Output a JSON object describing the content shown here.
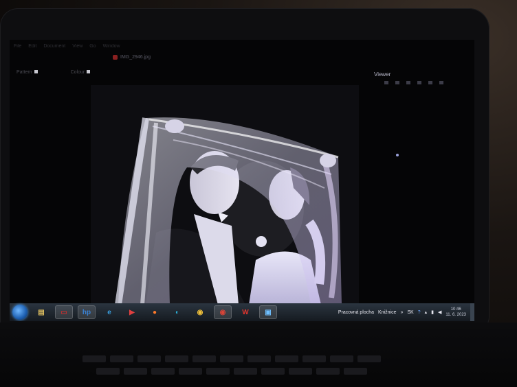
{
  "desktop": {
    "menu": [
      "File",
      "Edit",
      "Document",
      "View",
      "Go",
      "Window"
    ],
    "file_tab": "IMG_2946.jpg",
    "toolbar": {
      "left_label": "Pattern",
      "right_label": "Colour"
    },
    "viewer_label": "Viewer"
  },
  "taskbar": {
    "apps": [
      {
        "name": "start-button"
      },
      {
        "name": "explorer-icon",
        "glyph": "▤",
        "color": "#e0c060"
      },
      {
        "name": "card-icon",
        "glyph": "▭",
        "color": "#c03030"
      },
      {
        "name": "hp-icon",
        "glyph": "hp",
        "color": "#3a80d0"
      },
      {
        "name": "ie-icon",
        "glyph": "e",
        "color": "#3aa0e0"
      },
      {
        "name": "media-icon",
        "glyph": "▶",
        "color": "#e04040"
      },
      {
        "name": "firefox-icon",
        "glyph": "●",
        "color": "#ff7a2a"
      },
      {
        "name": "edge-icon",
        "glyph": "◐",
        "color": "#2bb0d8"
      },
      {
        "name": "chrome-icon-1",
        "glyph": "◉",
        "color": "#f2c23a"
      },
      {
        "name": "chrome-icon-2",
        "glyph": "◉",
        "color": "#db4437"
      },
      {
        "name": "wps-icon",
        "glyph": "W",
        "color": "#e0352e"
      },
      {
        "name": "viewer-app-icon",
        "glyph": "▣",
        "color": "#6fc0ff"
      }
    ],
    "desktop_label": "Pracovná plocha",
    "library_label": "Knižnice",
    "lang": "SK",
    "time": "10:46",
    "date": "11. 6. 2023"
  }
}
